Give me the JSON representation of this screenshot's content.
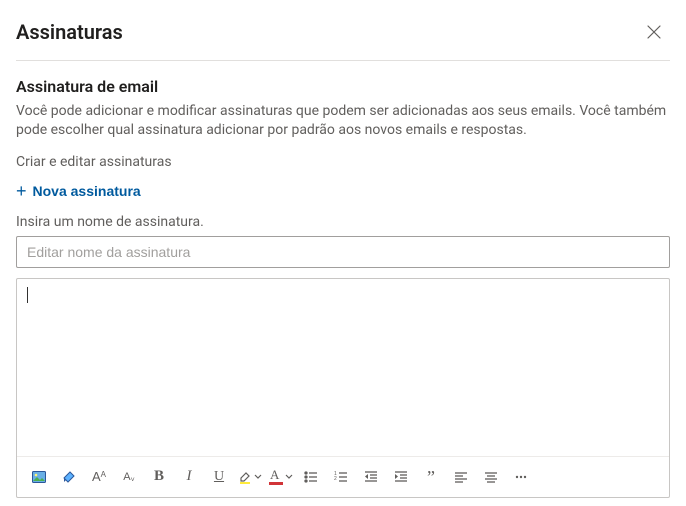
{
  "header": {
    "title": "Assinaturas"
  },
  "section": {
    "title": "Assinatura de email",
    "description": "Você pode adicionar e modificar assinaturas que podem ser adicionadas aos seus emails. Você também pode escolher qual assinatura adicionar por padrão aos novos emails e respostas.",
    "create_edit_label": "Criar e editar assinaturas",
    "new_signature_label": "Nova assinatura",
    "insert_name_hint": "Insira um nome de assinatura.",
    "name_input_placeholder": "Editar nome da assinatura"
  },
  "toolbar": {
    "items": [
      {
        "name": "insert-image-icon"
      },
      {
        "name": "format-painter-icon"
      },
      {
        "name": "font-size-increase-icon"
      },
      {
        "name": "font-size-decrease-icon"
      },
      {
        "name": "bold-icon"
      },
      {
        "name": "italic-icon"
      },
      {
        "name": "underline-icon"
      },
      {
        "name": "highlight-color-icon"
      },
      {
        "name": "font-color-icon"
      },
      {
        "name": "bulleted-list-icon"
      },
      {
        "name": "numbered-list-icon"
      },
      {
        "name": "decrease-indent-icon"
      },
      {
        "name": "increase-indent-icon"
      },
      {
        "name": "quote-icon"
      },
      {
        "name": "align-left-icon"
      },
      {
        "name": "align-center-icon"
      },
      {
        "name": "more-icon"
      }
    ]
  }
}
